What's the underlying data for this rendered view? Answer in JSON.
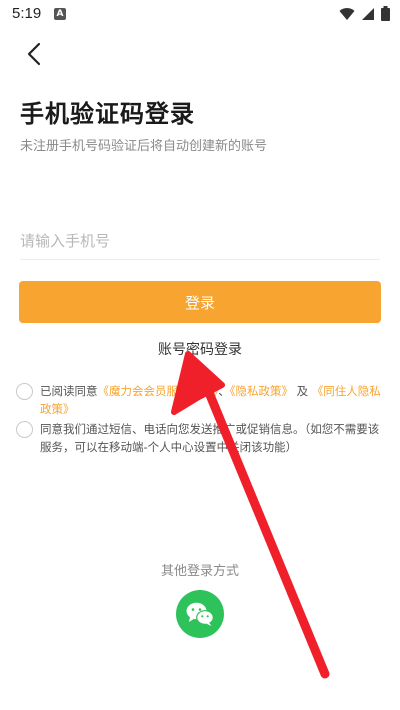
{
  "status_bar": {
    "time": "5:19",
    "notification_icon": "A",
    "icons": [
      "wifi-icon",
      "signal-icon",
      "battery-icon"
    ]
  },
  "header": {
    "back_icon": "chevron-left-icon"
  },
  "main": {
    "title": "手机验证码登录",
    "subtitle": "未注册手机号码验证后将自动创建新的账号",
    "phone_placeholder": "请输入手机号",
    "login_button": "登录",
    "password_login": "账号密码登录"
  },
  "agreements": {
    "row1": {
      "prefix": "已阅读同意",
      "link1": "《魔力会会员服务条款》",
      "mid": "、",
      "link2": "《隐私政策》",
      "and": "及",
      "link3": "《同住人隐私政策》"
    },
    "row2": {
      "text": "同意我们通过短信、电话向您发送推广或促销信息。（如您不需要该服务，可以在移动端-个人中心设置中关闭该功能）"
    }
  },
  "footer": {
    "other_login_label": "其他登录方式",
    "wechat_icon": "wechat-icon"
  },
  "colors": {
    "accent": "#f7a431",
    "wechat": "#2ec25a",
    "annotation_arrow": "#f0202a"
  }
}
